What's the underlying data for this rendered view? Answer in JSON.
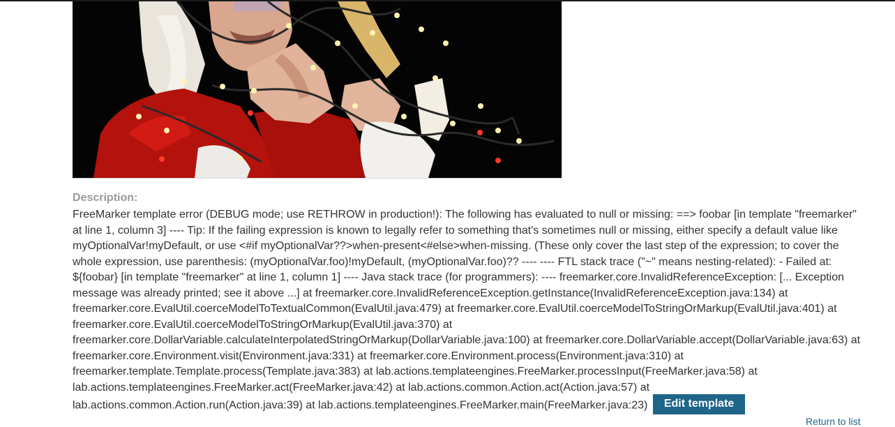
{
  "product": {
    "image_alt": "Santa with fairy lights"
  },
  "description": {
    "label": "Description:",
    "error_text": "FreeMarker template error (DEBUG mode; use RETHROW in production!): The following has evaluated to null or missing: ==> foobar [in template \"freemarker\" at line 1, column 3] ---- Tip: If the failing expression is known to legally refer to something that's sometimes null or missing, either specify a default value like myOptionalVar!myDefault, or use <#if myOptionalVar??>when-present<#else>when-missing. (These only cover the last step of the expression; to cover the whole expression, use parenthesis: (myOptionalVar.foo)!myDefault, (myOptionalVar.foo)?? ---- ---- FTL stack trace (\"~\" means nesting-related): - Failed at: ${foobar} [in template \"freemarker\" at line 1, column 1] ---- Java stack trace (for programmers): ---- freemarker.core.InvalidReferenceException: [... Exception message was already printed; see it above ...] at freemarker.core.InvalidReferenceException.getInstance(InvalidReferenceException.java:134) at freemarker.core.EvalUtil.coerceModelToTextualCommon(EvalUtil.java:479) at freemarker.core.EvalUtil.coerceModelToStringOrMarkup(EvalUtil.java:401) at freemarker.core.EvalUtil.coerceModelToStringOrMarkup(EvalUtil.java:370) at freemarker.core.DollarVariable.calculateInterpolatedStringOrMarkup(DollarVariable.java:100) at freemarker.core.DollarVariable.accept(DollarVariable.java:63) at freemarker.core.Environment.visit(Environment.java:331) at freemarker.core.Environment.process(Environment.java:310) at freemarker.template.Template.process(Template.java:383) at lab.actions.templateengines.FreeMarker.processInput(FreeMarker.java:58) at lab.actions.templateengines.FreeMarker.act(FreeMarker.java:42) at lab.actions.common.Action.act(Action.java:57) at lab.actions.common.Action.run(Action.java:39) at lab.actions.templateengines.FreeMarker.main(FreeMarker.java:23) "
  },
  "actions": {
    "edit_template_label": "Edit template"
  },
  "footer": {
    "link_label": "Return to list"
  },
  "colors": {
    "button_bg": "#1e6589",
    "label_gray": "#999999",
    "text": "#333333"
  }
}
